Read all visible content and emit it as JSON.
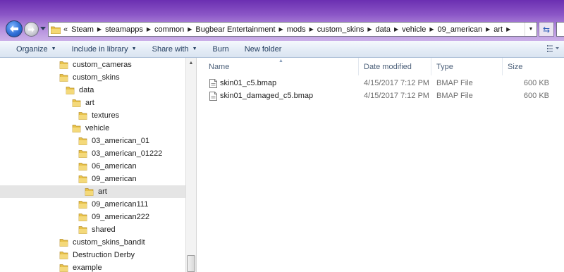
{
  "address_bar": {
    "overflow_indicator": "«",
    "breadcrumbs": [
      "Steam",
      "steamapps",
      "common",
      "Bugbear Entertainment",
      "mods",
      "custom_skins",
      "data",
      "vehicle",
      "09_american",
      "art"
    ]
  },
  "command_bar": {
    "organize": "Organize",
    "include_in_library": "Include in library",
    "share_with": "Share with",
    "burn": "Burn",
    "new_folder": "New folder"
  },
  "nav_tree": [
    {
      "label": "custom_cameras",
      "level": 0
    },
    {
      "label": "custom_skins",
      "level": 0
    },
    {
      "label": "data",
      "level": 1
    },
    {
      "label": "art",
      "level": 2
    },
    {
      "label": "textures",
      "level": 3
    },
    {
      "label": "vehicle",
      "level": 2
    },
    {
      "label": "03_american_01",
      "level": 3
    },
    {
      "label": "03_american_01222",
      "level": 3
    },
    {
      "label": "06_american",
      "level": 3
    },
    {
      "label": "09_american",
      "level": 3
    },
    {
      "label": "art",
      "level": 4,
      "selected": true
    },
    {
      "label": "09_american111",
      "level": 3
    },
    {
      "label": "09_american222",
      "level": 3
    },
    {
      "label": "shared",
      "level": 3
    },
    {
      "label": "custom_skins_bandit",
      "level": 0
    },
    {
      "label": "Destruction Derby",
      "level": 0
    },
    {
      "label": "example",
      "level": 0
    }
  ],
  "file_list": {
    "columns": {
      "name": "Name",
      "date_modified": "Date modified",
      "type": "Type",
      "size": "Size"
    },
    "files": [
      {
        "name": "skin01_c5.bmap",
        "date_modified": "4/15/2017 7:12 PM",
        "type": "BMAP File",
        "size": "600 KB"
      },
      {
        "name": "skin01_damaged_c5.bmap",
        "date_modified": "4/15/2017 7:12 PM",
        "type": "BMAP File",
        "size": "600 KB"
      }
    ]
  },
  "colors": {
    "title_accent": "#7b43bd",
    "folder_fill": "#e8c24a",
    "command_text": "#1e395b",
    "selected_row": "#e5e5e5"
  },
  "icons": {
    "back": "back-arrow-icon",
    "forward": "forward-arrow-icon",
    "refresh": "refresh-icon",
    "folder": "folder-icon",
    "file": "file-icon",
    "views": "views-icon"
  }
}
